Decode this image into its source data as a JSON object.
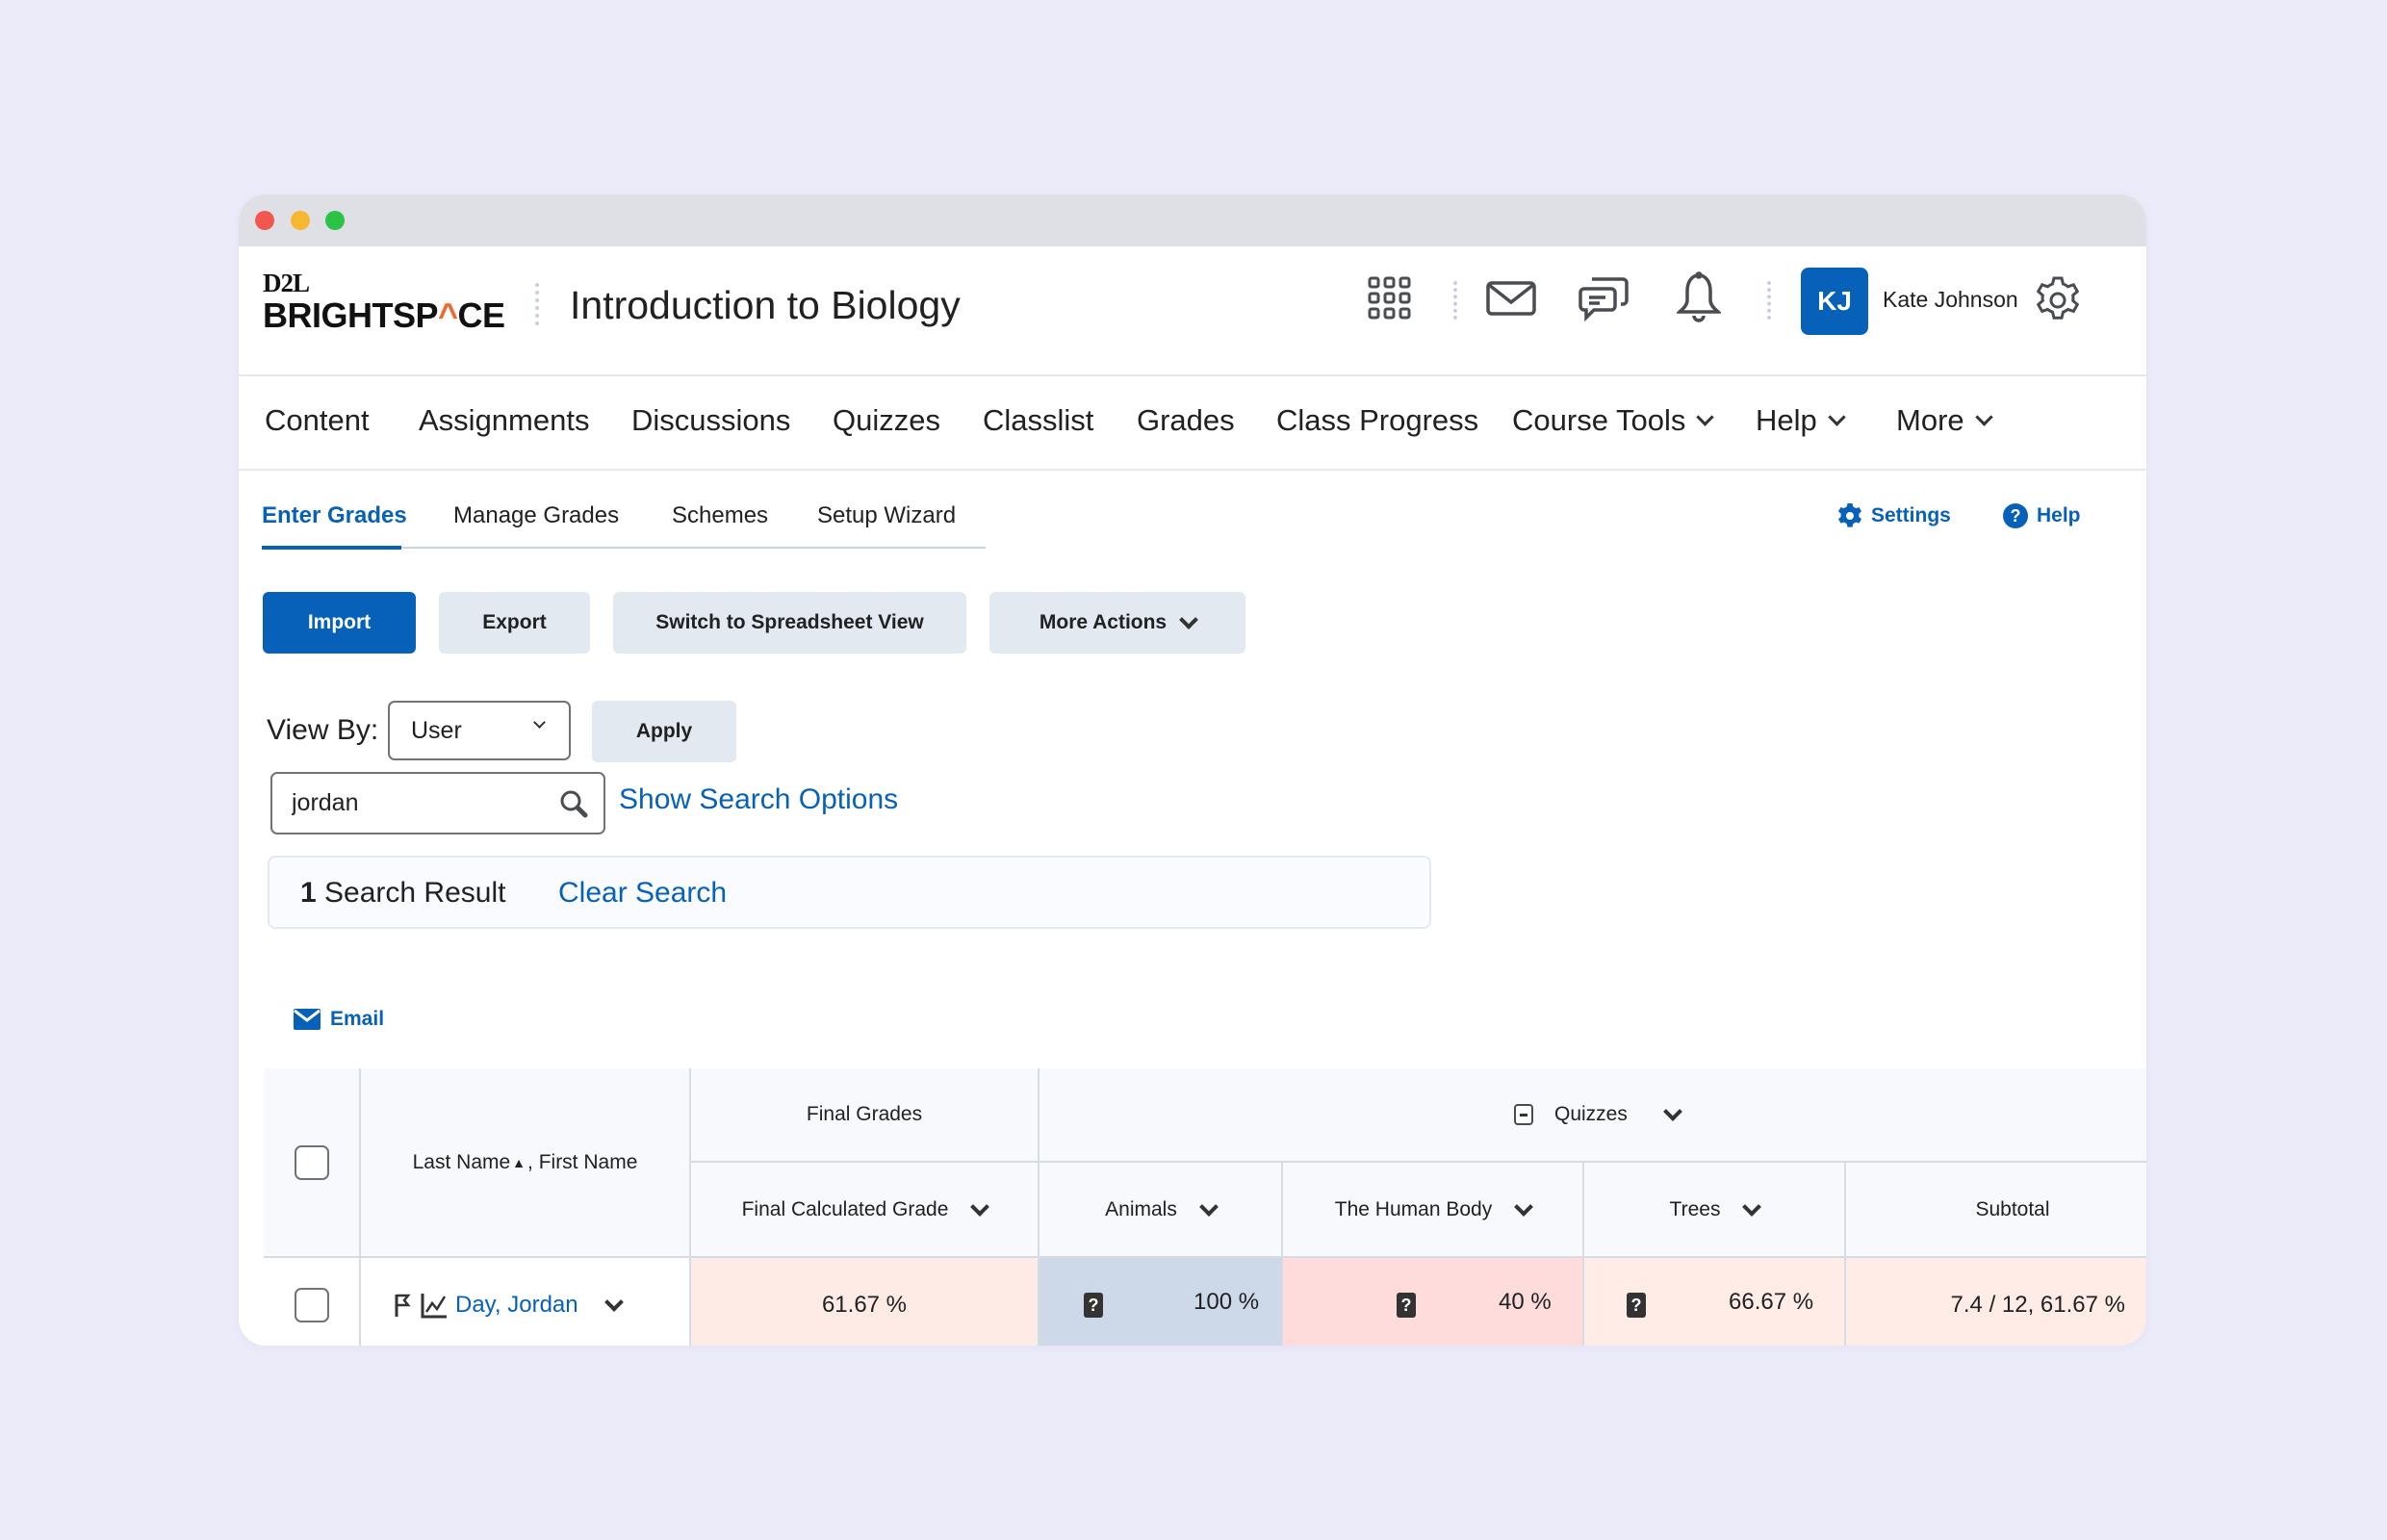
{
  "window": {
    "controls": [
      "close",
      "minimize",
      "maximize"
    ]
  },
  "header": {
    "logo_top": "D2L",
    "logo_bottom_pre": "BRIGHTSP",
    "logo_bottom_accent": "^",
    "logo_bottom_post": "CE",
    "course_title": "Introduction to Biology",
    "icons": [
      "apps-grid-icon",
      "mail-icon",
      "chat-icon",
      "bell-icon"
    ],
    "user_initials": "KJ",
    "user_name": "Kate Johnson",
    "avatar_color": "#0761b8"
  },
  "nav": {
    "items": [
      {
        "label": "Content",
        "dropdown": false
      },
      {
        "label": "Assignments",
        "dropdown": false
      },
      {
        "label": "Discussions",
        "dropdown": false
      },
      {
        "label": "Quizzes",
        "dropdown": false
      },
      {
        "label": "Classlist",
        "dropdown": false
      },
      {
        "label": "Grades",
        "dropdown": false
      },
      {
        "label": "Class Progress",
        "dropdown": false
      },
      {
        "label": "Course Tools",
        "dropdown": true
      },
      {
        "label": "Help",
        "dropdown": true
      },
      {
        "label": "More",
        "dropdown": true
      }
    ]
  },
  "subtabs": {
    "items": [
      "Enter Grades",
      "Manage Grades",
      "Schemes",
      "Setup Wizard"
    ],
    "active": "Enter Grades",
    "settings_label": "Settings",
    "help_label": "Help"
  },
  "toolbar": {
    "import_label": "Import",
    "export_label": "Export",
    "spreadsheet_label": "Switch to Spreadsheet View",
    "more_actions_label": "More Actions"
  },
  "filters": {
    "view_by_label": "View By:",
    "view_by_value": "User",
    "apply_label": "Apply",
    "search_value": "jordan",
    "show_search_options_label": "Show Search Options"
  },
  "results": {
    "count": "1",
    "label": "Search Result",
    "clear_label": "Clear Search"
  },
  "email_label": "Email",
  "table": {
    "name_header_last": "Last Name",
    "name_header_first": ", First Name",
    "group_final": "Final Grades",
    "group_quizzes": "Quizzes",
    "columns": {
      "final_calculated": "Final Calculated Grade",
      "animals": "Animals",
      "human_body": "The Human Body",
      "trees": "Trees",
      "subtotal": "Subtotal"
    },
    "rows": [
      {
        "name": "Day, Jordan",
        "final_calculated": "61.67 %",
        "animals": "100 %",
        "human_body": "40 %",
        "trees": "66.67 %",
        "subtotal": "7.4 / 12, 61.67 %"
      }
    ],
    "cell_colors": {
      "final_calculated": "#ffebe6",
      "animals": "#cdd8e8",
      "human_body": "#ffdcdc",
      "trees": "#ffece6",
      "subtotal": "#ffece6"
    }
  }
}
